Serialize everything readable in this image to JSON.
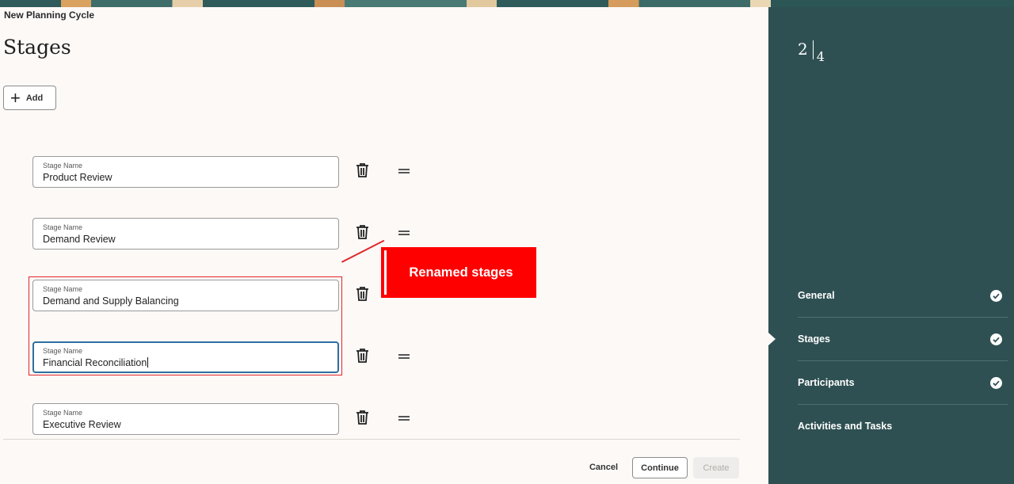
{
  "breadcrumb": "New Planning Cycle",
  "page_title": "Stages",
  "add_button": "Add",
  "stages": [
    {
      "label": "Stage Name",
      "value": "Product Review"
    },
    {
      "label": "Stage Name",
      "value": "Demand Review"
    },
    {
      "label": "Stage Name",
      "value": "Demand and Supply Balancing"
    },
    {
      "label": "Stage Name",
      "value": "Financial Reconciliation"
    },
    {
      "label": "Stage Name",
      "value": "Executive Review"
    }
  ],
  "callout": "Renamed stages",
  "footer": {
    "cancel": "Cancel",
    "continue": "Continue",
    "create": "Create"
  },
  "progress": {
    "current": "2",
    "total": "4"
  },
  "steps": [
    {
      "label": "General",
      "complete": true
    },
    {
      "label": "Stages",
      "complete": true
    },
    {
      "label": "Participants",
      "complete": true
    },
    {
      "label": "Activities and Tasks",
      "complete": false
    }
  ],
  "colors": {
    "panel": "#2f5052",
    "callout": "#ff0000",
    "accent": "#2d6fa0"
  }
}
